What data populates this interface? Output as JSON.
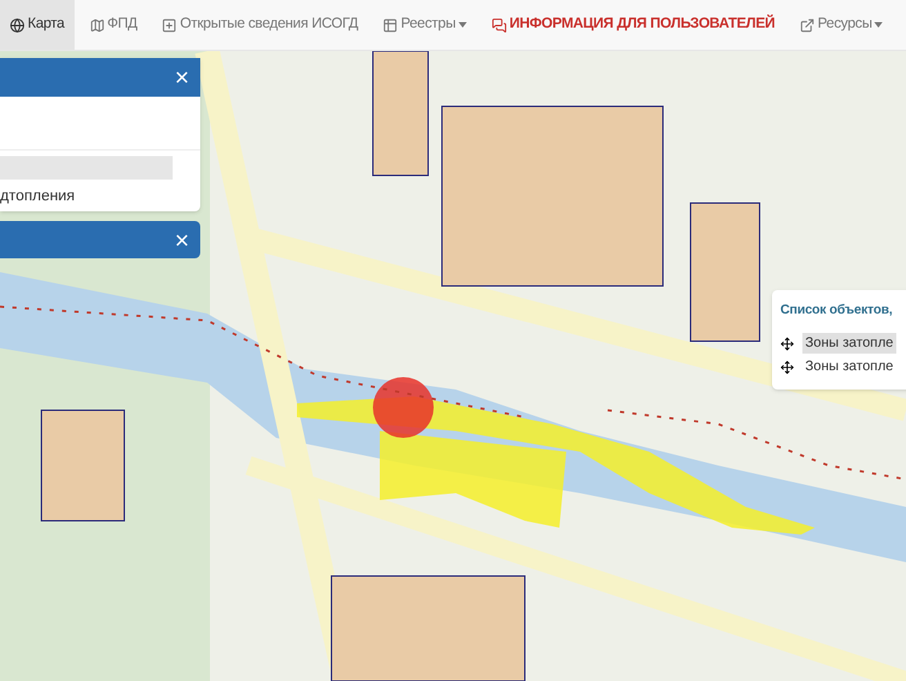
{
  "nav": {
    "items": [
      {
        "label": "Карта",
        "selected": true,
        "kind": "link"
      },
      {
        "label": "ФПД",
        "selected": false,
        "kind": "link"
      },
      {
        "label": "Открытые сведения ИСОГД",
        "selected": false,
        "kind": "link"
      },
      {
        "label": "Реестры",
        "selected": false,
        "kind": "dropdown"
      },
      {
        "label": "ИНФОРМАЦИЯ ДЛЯ ПОЛЬЗОВАТЕЛЕЙ",
        "selected": false,
        "kind": "highlight"
      },
      {
        "label": "Ресурсы",
        "selected": false,
        "kind": "dropdown"
      }
    ]
  },
  "panels": [
    {
      "close": "×",
      "text": "дтопления"
    },
    {
      "close": "×"
    }
  ],
  "objects_popup": {
    "title": "Список объектов,",
    "items": [
      {
        "label": "Зоны затопле",
        "selected": true
      },
      {
        "label": "Зоны затопле",
        "selected": false
      }
    ]
  }
}
